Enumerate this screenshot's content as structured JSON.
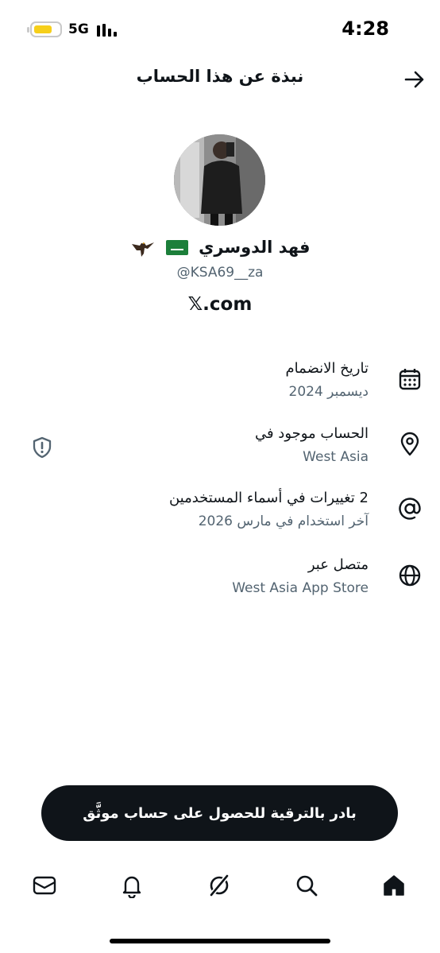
{
  "status_bar": {
    "network": "5G",
    "time": "4:28"
  },
  "header": {
    "title": "نبذة عن هذا الحساب"
  },
  "profile": {
    "display_name": "فهد الدوسري",
    "handle": "@KSA69__za",
    "website": "𝕏.com"
  },
  "details": [
    {
      "icon": "calendar-icon",
      "label": "تاريخ الانضمام",
      "value": "ديسمبر 2024"
    },
    {
      "icon": "location-pin-icon",
      "label": "الحساب موجود في",
      "value": "West Asia"
    },
    {
      "icon": "at-sign-icon",
      "label": "2 تغييرات في أسماء المستخدمين",
      "value": "آخر استخدام في مارس 2026"
    },
    {
      "icon": "globe-icon",
      "label": "متصل عبر",
      "value": "West Asia App Store"
    }
  ],
  "upgrade_button": {
    "label": "بادر بالترقية للحصول على حساب موثَّق"
  },
  "bottom_nav": [
    "home-icon",
    "search-icon",
    "grok-icon",
    "notifications-icon",
    "messages-icon"
  ],
  "colors": {
    "text": "#0f1419",
    "secondary": "#536471",
    "button_bg": "#0f1419",
    "flag_green": "#1c7f3a",
    "battery": "#f6cf1a"
  }
}
